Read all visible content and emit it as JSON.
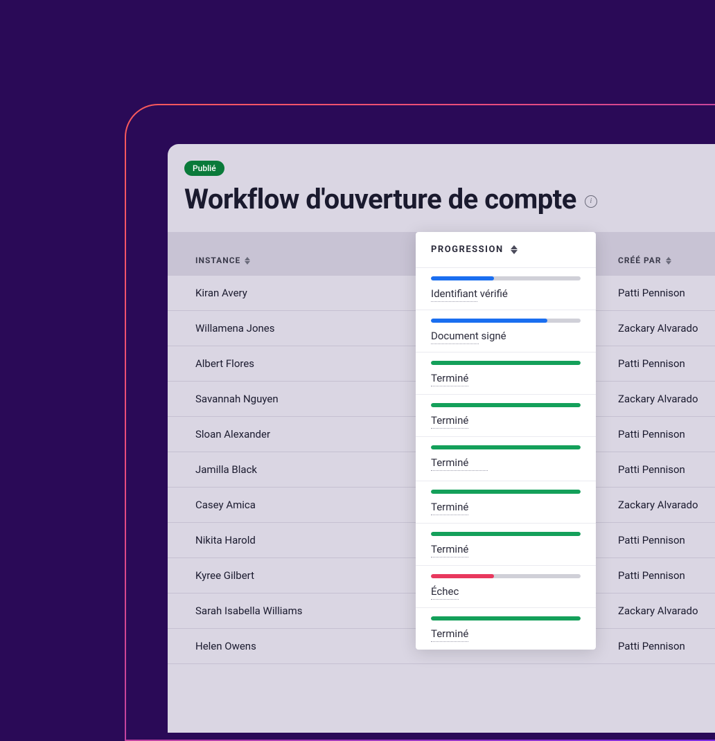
{
  "badge": "Publié",
  "title": "Workflow d'ouverture de compte",
  "columns": {
    "instance": "INSTANCE",
    "progression": "PROGRESSION",
    "created_by": "CRÉÉ PAR"
  },
  "rows": [
    {
      "instance": "Kiran Avery",
      "created_by": "Patti Pennison"
    },
    {
      "instance": "Willamena Jones",
      "created_by": "Zackary Alvarado"
    },
    {
      "instance": "Albert Flores",
      "created_by": "Patti Pennison"
    },
    {
      "instance": "Savannah Nguyen",
      "created_by": "Zackary Alvarado"
    },
    {
      "instance": "Sloan Alexander",
      "created_by": "Patti Pennison"
    },
    {
      "instance": "Jamilla Black",
      "created_by": "Patti Pennison"
    },
    {
      "instance": "Casey Amica",
      "created_by": "Zackary Alvarado"
    },
    {
      "instance": "Nikita Harold",
      "created_by": "Patti Pennison"
    },
    {
      "instance": "Kyree Gilbert",
      "created_by": "Patti Pennison"
    },
    {
      "instance": "Sarah Isabella Williams",
      "created_by": "Zackary Alvarado"
    },
    {
      "instance": "Helen Owens",
      "created_by": "Patti Pennison"
    }
  ],
  "progression": [
    {
      "label_underlined": "Identifiant",
      "label_rest": " vérifié",
      "percent": 42,
      "color": "blue"
    },
    {
      "label_underlined": "Document",
      "label_rest": " signé",
      "percent": 78,
      "color": "blue"
    },
    {
      "label_underlined": "Terminé",
      "label_rest": "",
      "percent": 100,
      "color": "green"
    },
    {
      "label_underlined": "Terminé",
      "label_rest": "",
      "percent": 100,
      "color": "green"
    },
    {
      "label_underlined": "Terminé",
      "label_rest": "",
      "percent": 100,
      "color": "green",
      "wide_underline": true
    },
    {
      "label_underlined": "Terminé",
      "label_rest": "",
      "percent": 100,
      "color": "green"
    },
    {
      "label_underlined": "Terminé",
      "label_rest": "",
      "percent": 100,
      "color": "green"
    },
    {
      "label_underlined": "Échec",
      "label_rest": "",
      "percent": 42,
      "color": "red"
    },
    {
      "label_underlined": "Terminé",
      "label_rest": "",
      "percent": 100,
      "color": "green"
    }
  ]
}
